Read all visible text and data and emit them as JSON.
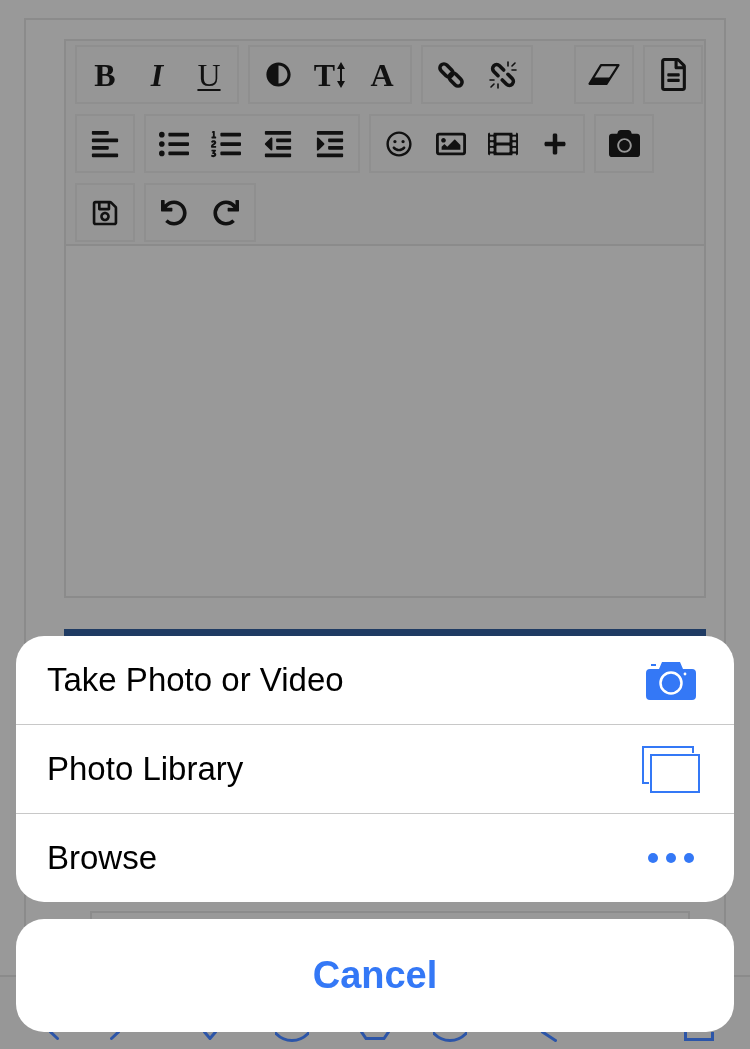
{
  "toolbar": {
    "bold": "B",
    "italic": "I",
    "underline": "U",
    "text_height": "T",
    "font": "A"
  },
  "action_sheet": {
    "options": [
      {
        "kind": "camera",
        "label": "Take Photo or Video"
      },
      {
        "kind": "library",
        "label": "Photo Library"
      },
      {
        "kind": "browse",
        "label": "Browse"
      }
    ],
    "cancel": "Cancel"
  }
}
